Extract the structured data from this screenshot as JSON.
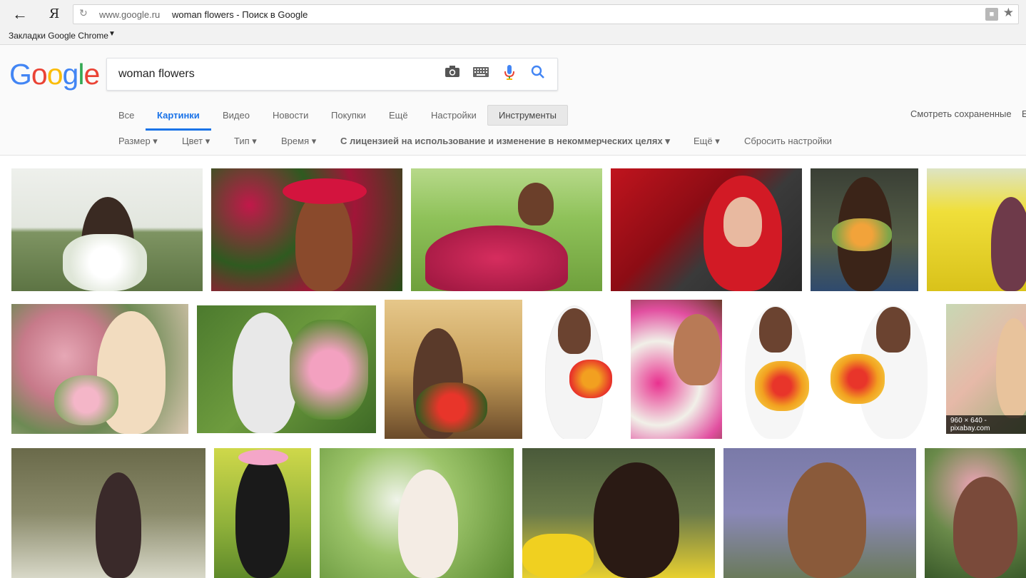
{
  "browser": {
    "url_domain": "www.google.ru",
    "url_title": "woman flowers - Поиск в Google",
    "yandex_glyph": "Я",
    "bookmarks_label": "Закладки Google Chrome"
  },
  "search": {
    "logo_letters": [
      "G",
      "o",
      "o",
      "g",
      "l",
      "e"
    ],
    "logo_colors": [
      "#4285F4",
      "#EA4335",
      "#FBBC05",
      "#4285F4",
      "#34A853",
      "#EA4335"
    ],
    "query": "woman flowers"
  },
  "tabs": [
    {
      "label": "Все"
    },
    {
      "label": "Картинки"
    },
    {
      "label": "Видео"
    },
    {
      "label": "Новости"
    },
    {
      "label": "Покупки"
    },
    {
      "label": "Ещё"
    },
    {
      "label": "Настройки"
    }
  ],
  "tools_label": "Инструменты",
  "saved_label": "Смотреть сохраненные",
  "saved_extra": "Е",
  "filters": [
    {
      "label": "Размер ▾"
    },
    {
      "label": "Цвет ▾"
    },
    {
      "label": "Тип ▾"
    },
    {
      "label": "Время ▾"
    },
    {
      "label": "С лицензией на использование и изменение в некоммерческих целях ▾"
    },
    {
      "label": "Ещё ▾"
    },
    {
      "label": "Сбросить настройки"
    }
  ],
  "hover_badge": "960 × 640 - pixabay.com",
  "accent_color": "#1a73e8"
}
